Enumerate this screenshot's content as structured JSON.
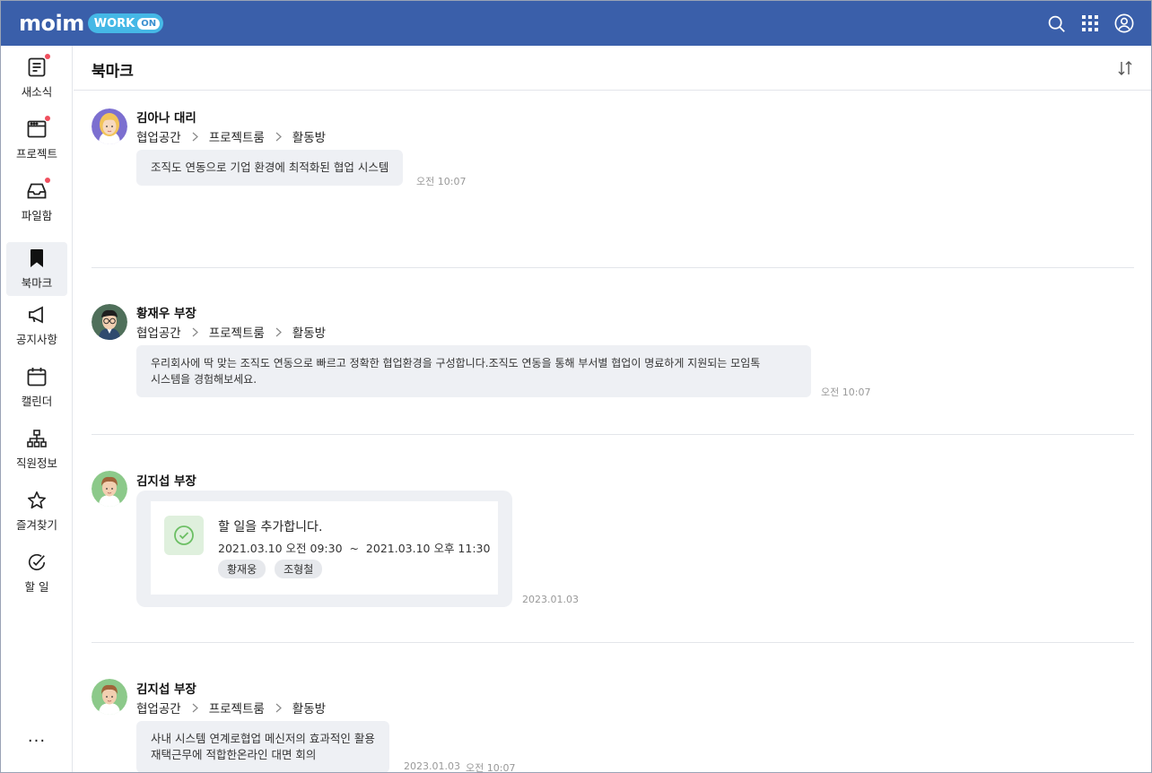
{
  "header": {
    "logo_main": "moim",
    "logo_work": "WORK",
    "logo_on": "ON",
    "icons": [
      "search-icon",
      "apps-grid-icon",
      "user-profile-icon"
    ]
  },
  "sidebar": {
    "items": [
      {
        "label": "새소식",
        "icon": "news-icon",
        "badge": true
      },
      {
        "label": "프로젝트",
        "icon": "project-icon",
        "badge": true
      },
      {
        "label": "파일함",
        "icon": "inbox-tray-icon",
        "badge": true
      },
      {
        "label": "북마크",
        "icon": "bookmark-icon",
        "badge": false,
        "active": true
      },
      {
        "label": "공지사항",
        "icon": "megaphone-icon",
        "badge": false
      },
      {
        "label": "캘린더",
        "icon": "calendar-icon",
        "badge": false
      },
      {
        "label": "직원정보",
        "icon": "org-chart-icon",
        "badge": false
      },
      {
        "label": "즐겨찾기",
        "icon": "star-icon",
        "badge": false
      },
      {
        "label": "할 일",
        "icon": "check-circle-icon",
        "badge": false
      }
    ],
    "more_label": "···"
  },
  "page": {
    "title": "북마크",
    "sort_icon": "sort-arrows-icon"
  },
  "posts": [
    {
      "author": "김아나 대리",
      "crumbs": [
        "협업공간",
        "프로젝트룸",
        "활동방"
      ],
      "message": "조직도 연동으로 기업 환경에 최적화된 협업 시스템",
      "time": "오전 10:07"
    },
    {
      "author": "황재우 부장",
      "crumbs": [
        "협업공간",
        "프로젝트룸",
        "활동방"
      ],
      "message_line1": "우리회사에 딱 맞는 조직도 연동으로 빠르고 정확한 협업환경을 구성합니다.조직도 연동을 통해 부서별 협업이 명료하게 지원되는 모임톡",
      "message_line2": "시스템을 경험해보세요.",
      "time": "오전 10:07"
    },
    {
      "author": "김지섭 부장",
      "todo": {
        "title": "할 일을 추가합니다.",
        "range": "2021.03.10 오전 09:30  ~  2021.03.10 오후 11:30",
        "tags": [
          "황재웅",
          "조형철"
        ]
      },
      "time": "2023.01.03"
    },
    {
      "author": "김지섭 부장",
      "crumbs": [
        "협업공간",
        "프로젝트룸",
        "활동방"
      ],
      "message_line1": "사내 시스템 연계로협업 메신저의 효과적인 활용",
      "message_line2": "재택근무에 적합한온라인 대면 회의",
      "date": "2023.01.03",
      "time": "오전 10:07"
    }
  ],
  "colors": {
    "header_bg": "#3a5faa",
    "badge": "#f04f5e",
    "bubble_bg": "#eef0f4",
    "todo_check_bg": "#dff0dd",
    "todo_check": "#6cbf64"
  }
}
